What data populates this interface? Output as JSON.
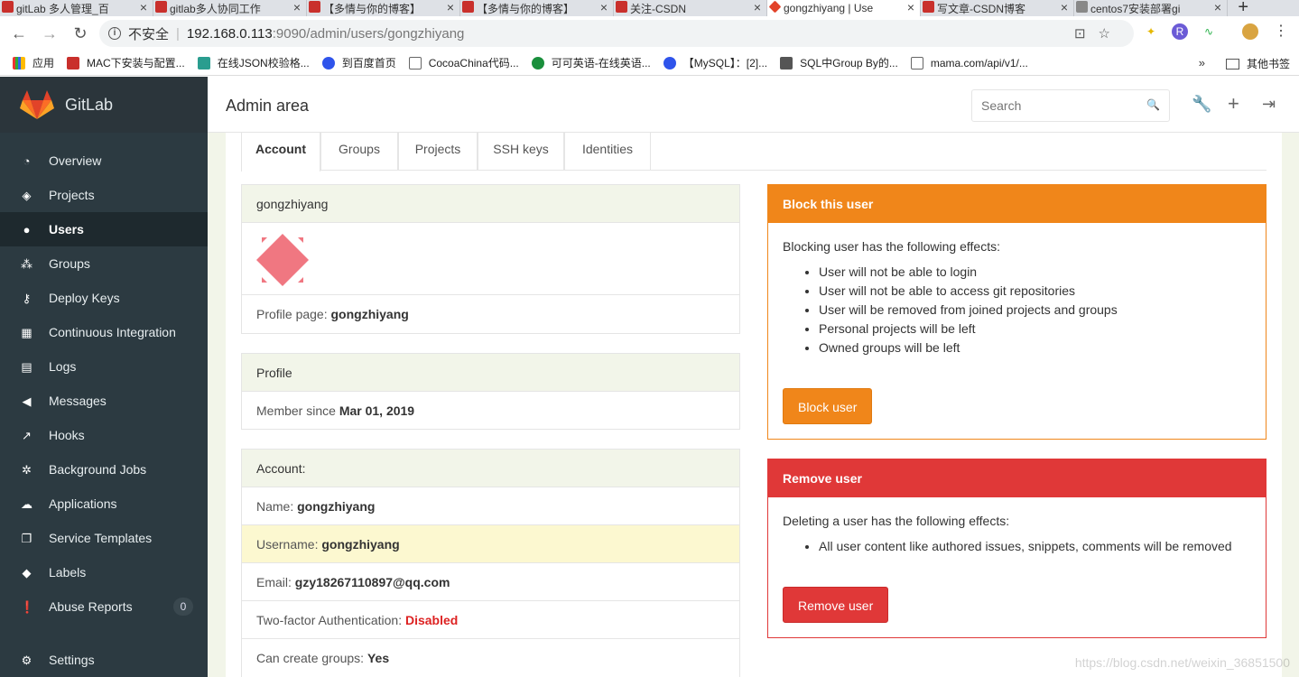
{
  "browser": {
    "tabs": [
      {
        "title": "gitLab 多人管理_百"
      },
      {
        "title": "gitlab多人协同工作"
      },
      {
        "title": "【多情与你的博客】"
      },
      {
        "title": "【多情与你的博客】"
      },
      {
        "title": "关注-CSDN"
      },
      {
        "title": "gongzhiyang | Use"
      },
      {
        "title": "写文章-CSDN博客"
      },
      {
        "title": "centos7安装部署gi"
      }
    ],
    "address": {
      "security_label": "不安全",
      "host": "192.168.0.113",
      "path": ":9090/admin/users/gongzhiyang"
    },
    "bookmarks": [
      {
        "label": "应用"
      },
      {
        "label": "MAC下安装与配置..."
      },
      {
        "label": "在线JSON校验格..."
      },
      {
        "label": "到百度首页"
      },
      {
        "label": "CocoaChina代码..."
      },
      {
        "label": "可可英语-在线英语..."
      },
      {
        "label": "【MySQL】：[2]..."
      },
      {
        "label": "SQL中Group By的..."
      },
      {
        "label": "mama.com/api/v1/..."
      }
    ],
    "bookmarks_more": "»",
    "other_bookmarks": "其他书签"
  },
  "sidebar": {
    "app_name": "GitLab",
    "items": [
      {
        "label": "Overview",
        "icon": "dashboard-icon"
      },
      {
        "label": "Projects",
        "icon": "cube-icon"
      },
      {
        "label": "Users",
        "icon": "user-icon",
        "active": true
      },
      {
        "label": "Groups",
        "icon": "users-icon"
      },
      {
        "label": "Deploy Keys",
        "icon": "key-icon"
      },
      {
        "label": "Continuous Integration",
        "icon": "building-icon"
      },
      {
        "label": "Logs",
        "icon": "file-icon"
      },
      {
        "label": "Messages",
        "icon": "bullhorn-icon"
      },
      {
        "label": "Hooks",
        "icon": "external-link-icon"
      },
      {
        "label": "Background Jobs",
        "icon": "cog-icon"
      },
      {
        "label": "Applications",
        "icon": "cloud-icon"
      },
      {
        "label": "Service Templates",
        "icon": "copy-icon"
      },
      {
        "label": "Labels",
        "icon": "tags-icon"
      },
      {
        "label": "Abuse Reports",
        "icon": "exclamation-circle-icon",
        "badge": "0"
      }
    ],
    "settings_label": "Settings"
  },
  "header": {
    "title": "Admin area",
    "search_placeholder": "Search"
  },
  "user_tabs": [
    "Account",
    "Groups",
    "Projects",
    "SSH keys",
    "Identities"
  ],
  "user_panel": {
    "username": "gongzhiyang",
    "profile_page_label": "Profile page:",
    "profile_page_value": "gongzhiyang"
  },
  "profile_panel": {
    "heading": "Profile",
    "member_since_label": "Member since",
    "member_since_value": "Mar 01, 2019"
  },
  "account_panel": {
    "heading": "Account:",
    "name_label": "Name:",
    "name_value": "gongzhiyang",
    "username_label": "Username:",
    "username_value": "gongzhiyang",
    "email_label": "Email:",
    "email_value": "gzy18267110897@qq.com",
    "twofa_label": "Two-factor Authentication:",
    "twofa_value": "Disabled",
    "create_groups_label": "Can create groups:",
    "create_groups_value": "Yes"
  },
  "block_panel": {
    "heading": "Block this user",
    "intro": "Blocking user has the following effects:",
    "effects": [
      "User will not be able to login",
      "User will not be able to access git repositories",
      "User will be removed from joined projects and groups",
      "Personal projects will be left",
      "Owned groups will be left"
    ],
    "button": "Block user",
    "color": "#f0861a"
  },
  "remove_panel": {
    "heading": "Remove user",
    "intro": "Deleting a user has the following effects:",
    "effects": [
      "All user content like authored issues, snippets, comments will be removed"
    ],
    "button": "Remove user",
    "color": "#e03838"
  },
  "watermark": "https://blog.csdn.net/weixin_36851500"
}
